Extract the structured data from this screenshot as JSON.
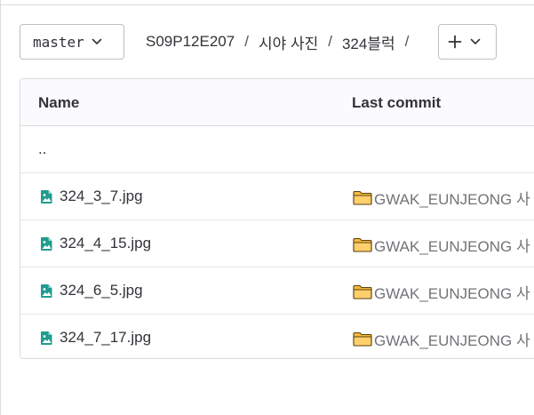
{
  "branch": {
    "label": "master"
  },
  "breadcrumb": [
    {
      "label": "S09P12E207"
    },
    {
      "label": "시야 사진"
    },
    {
      "label": "324블럭"
    }
  ],
  "breadcrumb_separator": "/",
  "table": {
    "headers": {
      "name": "Name",
      "last_commit": "Last commit"
    },
    "parent_dir": "..",
    "files": [
      {
        "name": "324_3_7.jpg",
        "commit": "GWAK_EUNJEONG 사"
      },
      {
        "name": "324_4_15.jpg",
        "commit": "GWAK_EUNJEONG 사"
      },
      {
        "name": "324_6_5.jpg",
        "commit": "GWAK_EUNJEONG 사"
      },
      {
        "name": "324_7_17.jpg",
        "commit": "GWAK_EUNJEONG 사"
      }
    ]
  },
  "icons": {
    "file": "image-file-icon",
    "folder": "folder-icon",
    "chevron": "chevron-down-icon",
    "plus": "plus-icon"
  },
  "colors": {
    "file_icon": "#1f9c8f",
    "folder_fill": "#ffcf6b",
    "border": "#dcdcde"
  }
}
